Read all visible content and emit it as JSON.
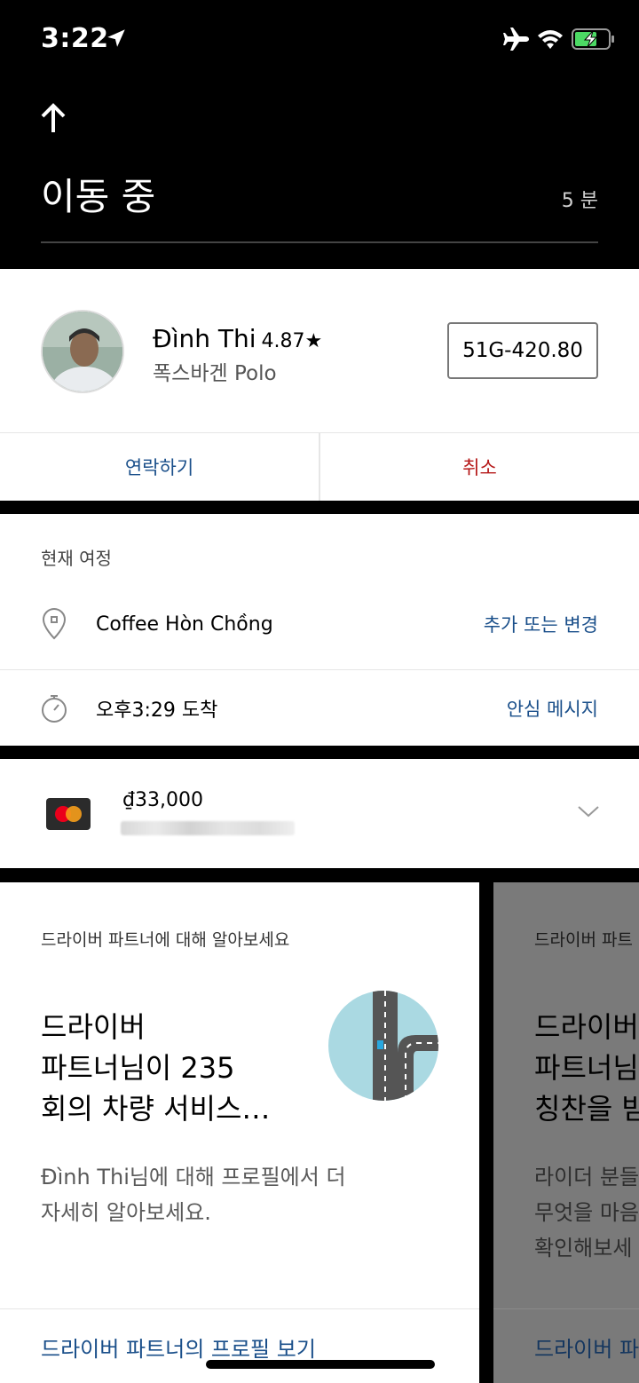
{
  "status_bar": {
    "time": "3:22"
  },
  "header": {
    "title": "이동 중",
    "eta": "5 분"
  },
  "driver": {
    "name": "Đình Thi",
    "rating": "4.87★",
    "car": "폭스바겐 Polo",
    "plate": "51G-420.80"
  },
  "actions": {
    "contact": "연락하기",
    "cancel": "취소"
  },
  "trip": {
    "heading": "현재 여정",
    "destination": "Coffee Hòn Chồng",
    "destination_action": "추가 또는 변경",
    "arrival": "오후3:29 도착",
    "arrival_action": "안심 메시지"
  },
  "payment": {
    "fare": "₫33,000"
  },
  "promo": {
    "eyebrow": "드라이버 파트너에 대해 알아보세요",
    "title_lines": [
      "드라이버",
      "파트너님이 235",
      "회의 차량 서비스…"
    ],
    "body_lines": [
      "Đình Thi님에 대해 프로필에서 더",
      "자세히 알아보세요."
    ],
    "link": "드라이버 파트너의 프로필 보기"
  },
  "promo_next": {
    "eyebrow": "드라이버 파트",
    "title_lines": [
      "드라이버",
      "파트너님",
      "칭찬을 받"
    ],
    "body_lines": [
      "라이더 분들",
      "무엇을 마음",
      "확인해보세"
    ],
    "link": "드라이버 파"
  },
  "colors": {
    "link_blue": "#1a4f8a",
    "cancel_red": "#b51818"
  }
}
